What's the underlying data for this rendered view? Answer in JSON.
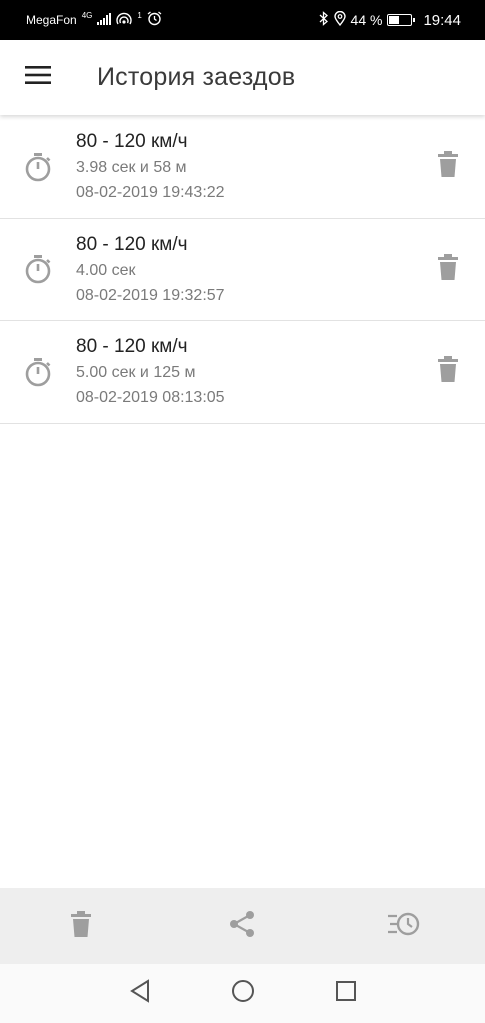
{
  "status_bar": {
    "carrier": "MegaFon",
    "network": "4G",
    "hotspot_count": "1",
    "battery_percent": "44 %",
    "battery_level": 0.44,
    "time": "19:44"
  },
  "app_bar": {
    "title": "История заездов",
    "menu_icon": "hamburger-menu-icon"
  },
  "runs": [
    {
      "title": "80 - 120 км/ч",
      "result": "3.98 сек и 58 м",
      "date": "08-02-2019 19:43:22"
    },
    {
      "title": "80 - 120 км/ч",
      "result": "4.00 сек",
      "date": "08-02-2019 19:32:57"
    },
    {
      "title": "80 - 120 км/ч",
      "result": "5.00 сек и 125 м",
      "date": "08-02-2019 08:13:05"
    }
  ],
  "bottom_actions": [
    "delete-all-icon",
    "share-icon",
    "history-icon"
  ],
  "nav_bar": [
    "back-icon",
    "home-icon",
    "recents-icon"
  ],
  "colors": {
    "icon_gray": "#9e9e9e",
    "divider": "#e2e2e2",
    "action_bar_bg": "#eeeeee"
  }
}
